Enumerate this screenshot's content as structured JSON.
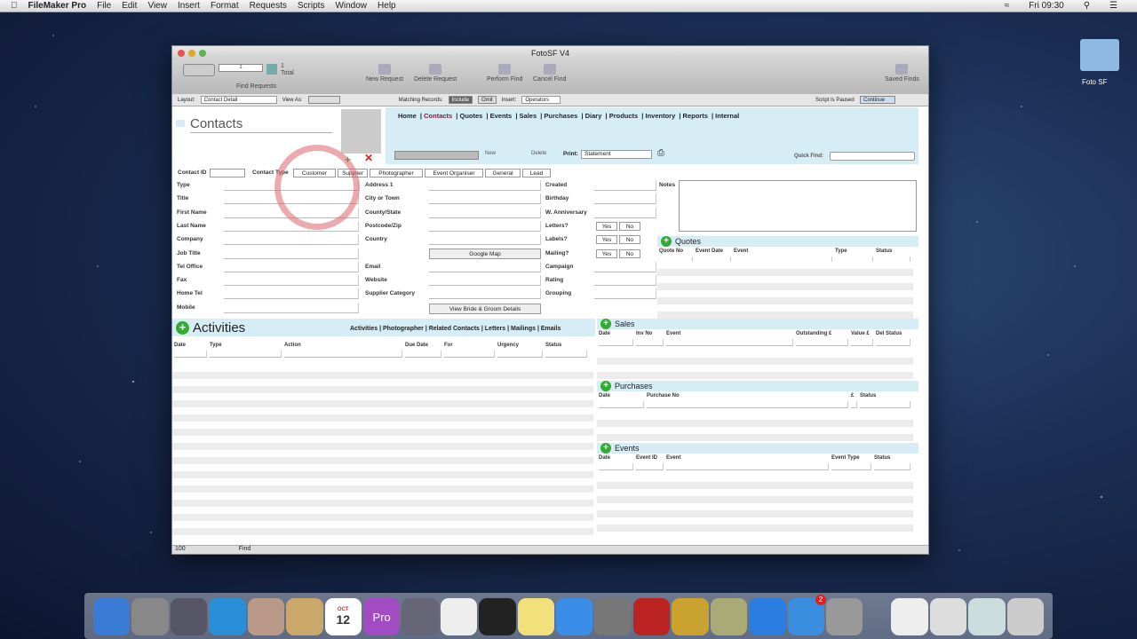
{
  "menubar": {
    "apple": "",
    "app": "FileMaker Pro",
    "items": [
      "File",
      "Edit",
      "View",
      "Insert",
      "Format",
      "Requests",
      "Scripts",
      "Window",
      "Help"
    ],
    "clock": "Fri 09:30"
  },
  "window": {
    "title": "FotoSF V4"
  },
  "toolbar": {
    "record_count": "1",
    "total_count": "1",
    "total_label": "Total",
    "find_requests": "Find Requests",
    "new_request": "New Request",
    "delete_request": "Delete Request",
    "perform_find": "Perform Find",
    "cancel_find": "Cancel Find",
    "saved_finds": "Saved Finds"
  },
  "layoutbar": {
    "layout_label": "Layout:",
    "layout_value": "Contact Detail",
    "view_as": "View As:",
    "matching": "Matching Records:",
    "include": "Include",
    "omit": "Omit",
    "insert_label": "Insert:",
    "insert_value": "Operators",
    "script_status": "Script Is Paused",
    "continue": "Continue"
  },
  "page": {
    "title": "Contacts",
    "nav": [
      "Home",
      "Contacts",
      "Quotes",
      "Events",
      "Sales",
      "Purchases",
      "Diary",
      "Products",
      "Inventory",
      "Reports",
      "Internal"
    ],
    "new": "New",
    "delete": "Delete",
    "print_label": "Print:",
    "print_value": "Statement",
    "quick_find": "Quick Find:"
  },
  "contact_bar": {
    "contact_id": "Contact ID",
    "contact_type": "Contact Type",
    "types": [
      "Customer",
      "Supplier",
      "Photographer",
      "Event Organiser",
      "General",
      "Lead"
    ]
  },
  "col1_labels": [
    "Type",
    "Title",
    "First Name",
    "Last Name",
    "Company",
    "Job Title",
    "Tel Office",
    "Fax",
    "Home Tel",
    "Mobile"
  ],
  "col2_labels": [
    "Address 1",
    "City or Town",
    "County/State",
    "Postcode/Zip",
    "Country",
    "",
    "Email",
    "Website",
    "Supplier Category"
  ],
  "col3_labels": [
    "Created",
    "Birthday",
    "W. Anniversary",
    "Letters?",
    "Labels?",
    "Mailing?",
    "Campaign",
    "Rating",
    "Grouping"
  ],
  "yesno": {
    "yes": "Yes",
    "no": "No"
  },
  "buttons": {
    "google_map": "Google Map",
    "bride_groom": "View Bride & Groom Details"
  },
  "notes_label": "Notes",
  "quotes": {
    "title": "Quotes",
    "cols": [
      "Quote No",
      "Event Date",
      "Event",
      "Type",
      "Status"
    ]
  },
  "activities": {
    "title": "Activities",
    "links": [
      "Activities",
      "Photographer",
      "Related Contacts",
      "Letters",
      "Mailings",
      "Emails"
    ],
    "cols": [
      "Date",
      "Type",
      "Action",
      "Due Date",
      "For",
      "Urgency",
      "Status"
    ]
  },
  "sales": {
    "title": "Sales",
    "cols": [
      "Date",
      "Inv No",
      "Event",
      "Outstanding £",
      "Value £",
      "Del Status"
    ]
  },
  "purchases": {
    "title": "Purchases",
    "cols": [
      "Date",
      "Purchase No",
      "£",
      "Status"
    ]
  },
  "events": {
    "title": "Events",
    "cols": [
      "Date",
      "Event ID",
      "Event",
      "Event Type",
      "Status"
    ]
  },
  "statusbar": {
    "zoom": "100",
    "mode": "Find"
  },
  "desktop": {
    "folder": "Foto SF"
  },
  "dock": {
    "calendar_day": "12",
    "calendar_month": "OCT",
    "pro": "Pro",
    "badge": "2"
  }
}
